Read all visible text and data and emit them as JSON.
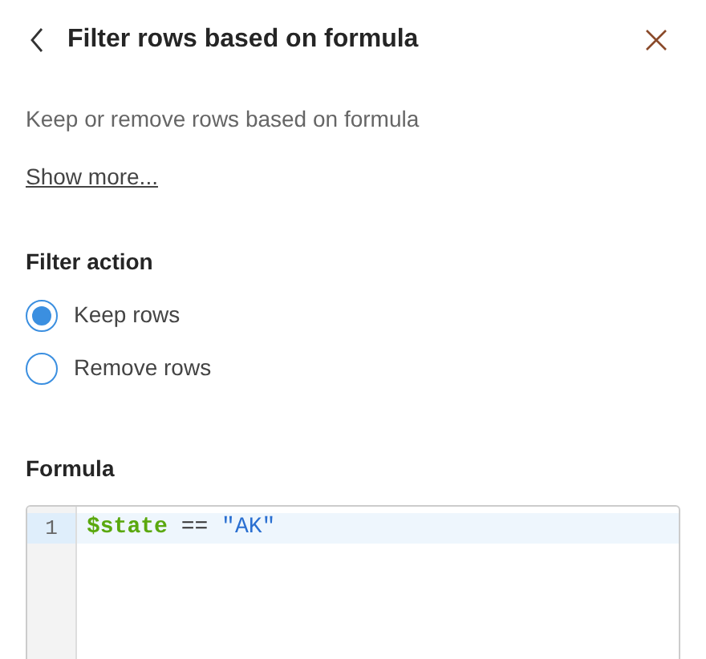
{
  "header": {
    "title": "Filter rows based on formula"
  },
  "description": "Keep or remove rows based on formula",
  "show_more": "Show more...",
  "filter_action": {
    "label": "Filter action",
    "options": [
      {
        "label": "Keep rows",
        "selected": true
      },
      {
        "label": "Remove rows",
        "selected": false
      }
    ]
  },
  "formula": {
    "label": "Formula",
    "lines": [
      {
        "number": "1",
        "active": true,
        "tokens": [
          {
            "kind": "variable",
            "text": "$state"
          },
          {
            "kind": "operator",
            "text": "=="
          },
          {
            "kind": "string",
            "text": "\"AK\""
          }
        ]
      }
    ]
  }
}
